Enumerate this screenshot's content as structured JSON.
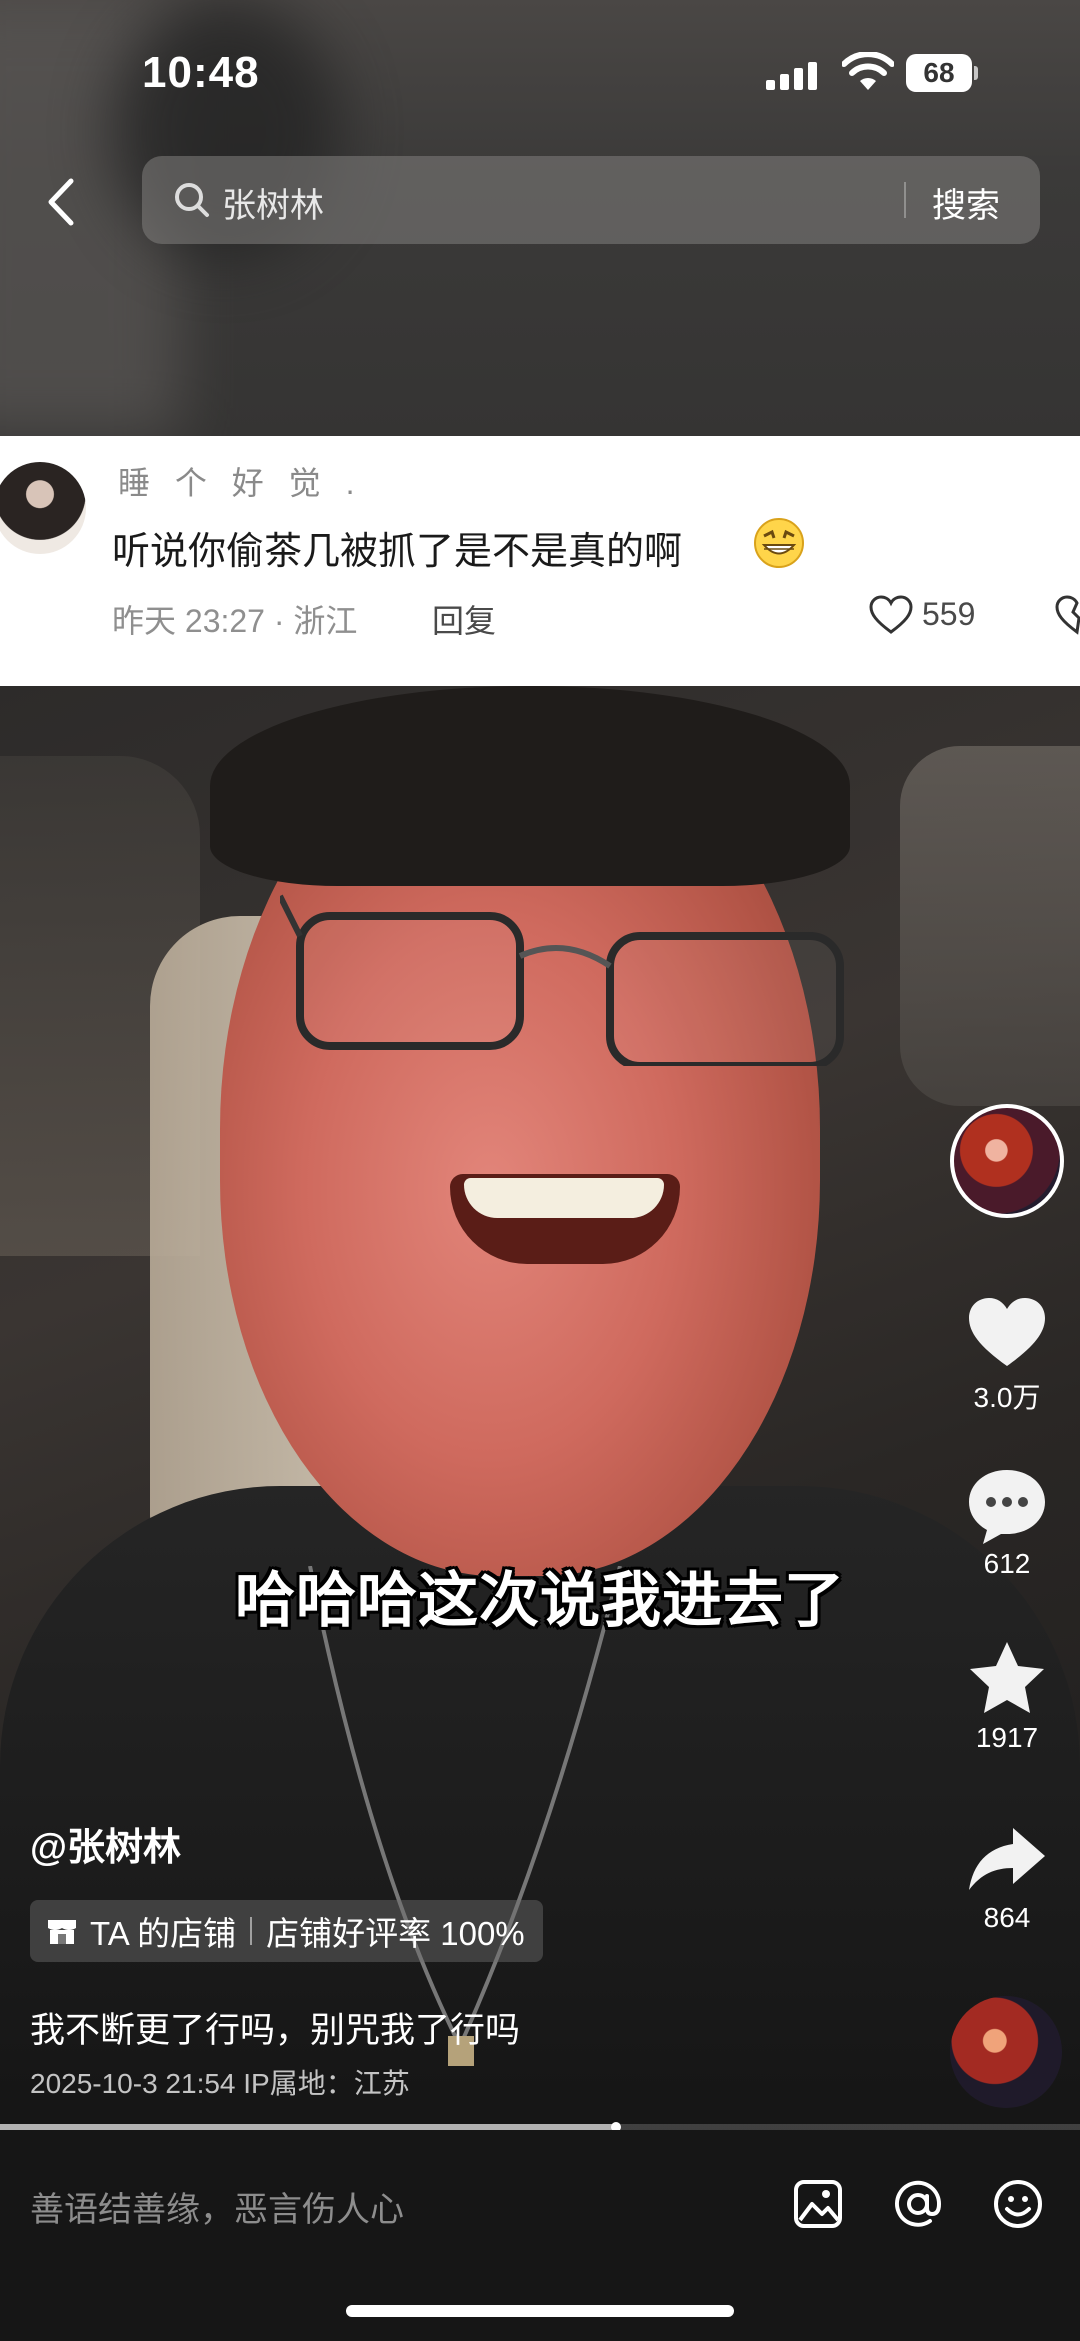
{
  "status_bar": {
    "time": "10:48",
    "battery": "68"
  },
  "search": {
    "query": "张树林",
    "button_label": "搜索"
  },
  "comment": {
    "username": "睡 个 好 觉 .",
    "text": "听说你偷茶几被抓了是不是真的啊",
    "meta": "昨天 23:27 · 浙江",
    "reply_label": "回复",
    "likes": "559"
  },
  "video": {
    "subtitle": "哈哈哈这次说我进去了",
    "author": "@张树林",
    "shop_label": "TA 的店铺",
    "shop_rating": "店铺好评率 100%",
    "caption": "我不断更了行吗，别咒我了行吗",
    "post_meta": "2025-10-3 21:54   IP属地：江苏",
    "progress": 0.57
  },
  "actions": {
    "likes": "3.0万",
    "comments": "612",
    "favorites": "1917",
    "shares": "864"
  },
  "input": {
    "placeholder": "善语结善缘，恶言伤人心"
  },
  "icons": [
    "back-icon",
    "search-icon",
    "heart-icon",
    "comment-icon",
    "star-icon",
    "share-icon",
    "image-icon",
    "at-icon",
    "emoji-icon",
    "shop-icon"
  ]
}
